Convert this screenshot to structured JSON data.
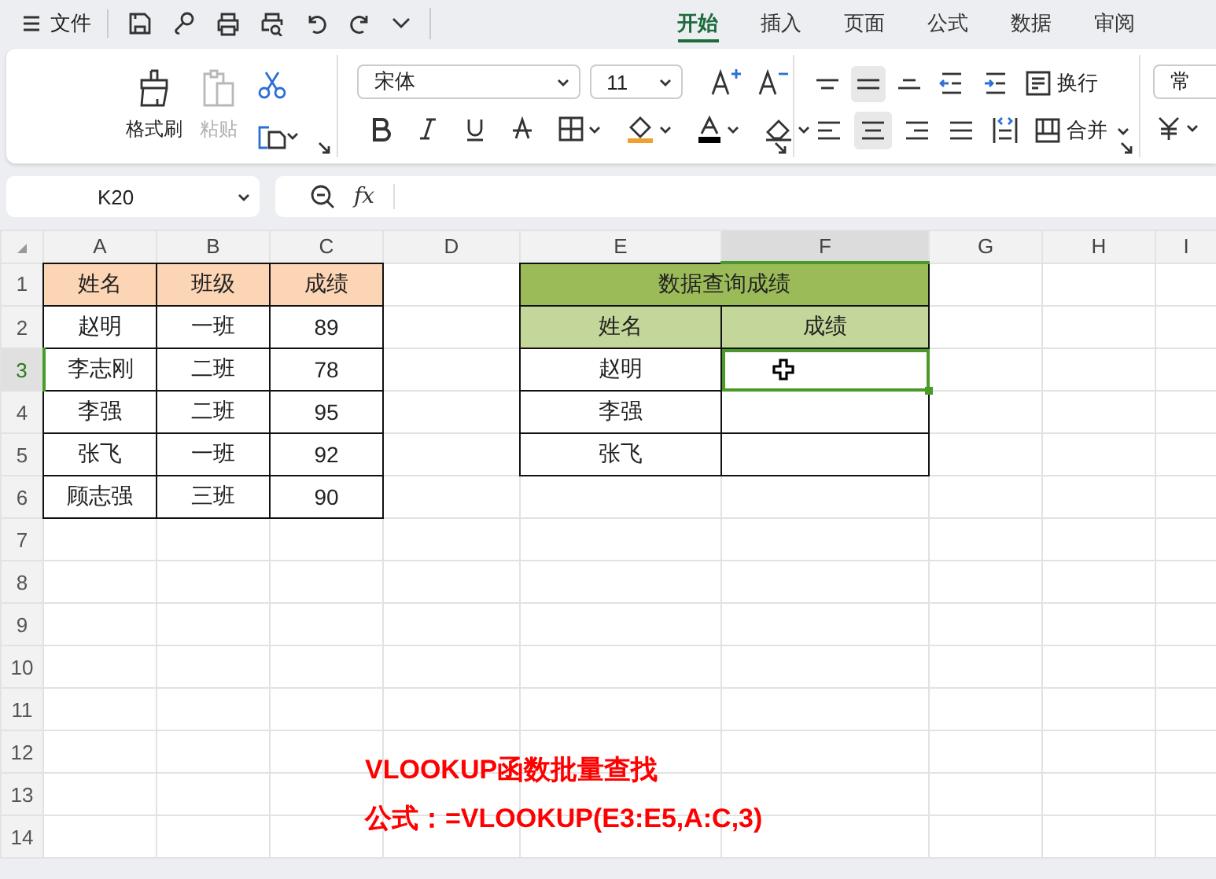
{
  "menu": {
    "label": "文件"
  },
  "tabs": [
    {
      "label": "开始",
      "selected": true
    },
    {
      "label": "插入",
      "selected": false
    },
    {
      "label": "页面",
      "selected": false
    },
    {
      "label": "公式",
      "selected": false
    },
    {
      "label": "数据",
      "selected": false
    },
    {
      "label": "审阅",
      "selected": false
    }
  ],
  "ribbon": {
    "format_painter": "格式刷",
    "paste": {
      "label": "粘贴",
      "disabled": true
    },
    "font": "宋体",
    "font_size": "11",
    "wrap": "换行",
    "merge": "合并",
    "number_format": "常"
  },
  "name_box": "K20",
  "formula_label": "fx",
  "sheet": {
    "columns": [
      {
        "label": "A",
        "selected": false
      },
      {
        "label": "B",
        "selected": false
      },
      {
        "label": "C",
        "selected": false
      },
      {
        "label": "D",
        "selected": false
      },
      {
        "label": "E",
        "selected": false
      },
      {
        "label": "F",
        "selected": true
      },
      {
        "label": "G",
        "selected": false
      },
      {
        "label": "H",
        "selected": false
      },
      {
        "label": "I",
        "selected": false
      }
    ],
    "rows": [
      {
        "label": "1",
        "selected": false
      },
      {
        "label": "2",
        "selected": false
      },
      {
        "label": "3",
        "selected": true
      },
      {
        "label": "4",
        "selected": false
      },
      {
        "label": "5",
        "selected": false
      },
      {
        "label": "6",
        "selected": false
      },
      {
        "label": "7",
        "selected": false
      },
      {
        "label": "8",
        "selected": false
      },
      {
        "label": "9",
        "selected": false
      },
      {
        "label": "10",
        "selected": false
      },
      {
        "label": "11",
        "selected": false
      },
      {
        "label": "12",
        "selected": false
      },
      {
        "label": "13",
        "selected": false
      },
      {
        "label": "14",
        "selected": false
      }
    ],
    "source_table": {
      "header": [
        "姓名",
        "班级",
        "成绩"
      ],
      "rows": [
        [
          "赵明",
          "一班",
          "89"
        ],
        [
          "李志刚",
          "二班",
          "78"
        ],
        [
          "李强",
          "二班",
          "95"
        ],
        [
          "张飞",
          "一班",
          "92"
        ],
        [
          "顾志强",
          "三班",
          "90"
        ]
      ]
    },
    "lookup_table": {
      "title": "数据查询成绩",
      "header": [
        "姓名",
        "成绩"
      ],
      "rows": [
        {
          "name": "赵明",
          "selected": true
        },
        {
          "name": "李强",
          "selected": false
        },
        {
          "name": "张飞",
          "selected": false
        }
      ]
    }
  },
  "note": [
    "VLOOKUP函数批量查找",
    "公式：=VLOOKUP(E3:E5,A:C,3)"
  ]
}
